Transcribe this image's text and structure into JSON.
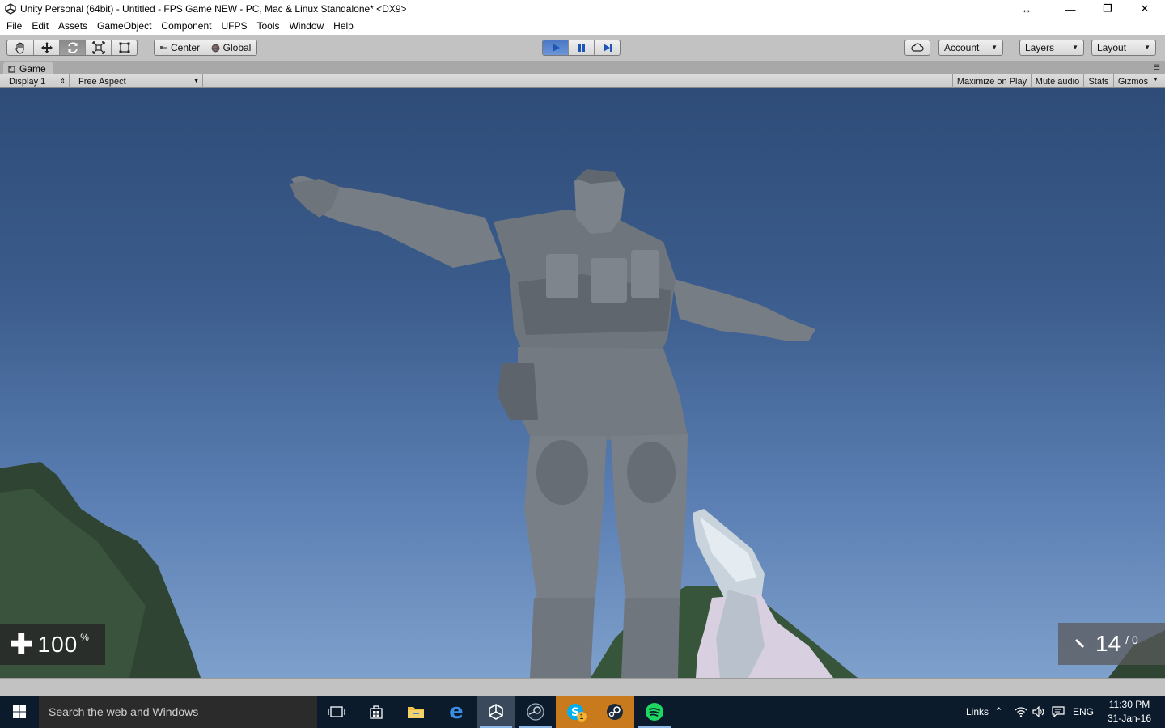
{
  "window": {
    "title": "Unity Personal (64bit) - Untitled - FPS Game NEW - PC, Mac & Linux Standalone* <DX9>",
    "controls": {
      "minimize": "—",
      "restore": "❐",
      "close": "✕",
      "resize": "↔"
    }
  },
  "menubar": [
    "File",
    "Edit",
    "Assets",
    "GameObject",
    "Component",
    "UFPS",
    "Tools",
    "Window",
    "Help"
  ],
  "toolbar": {
    "tools": [
      "hand-tool-icon",
      "move-tool-icon",
      "rotate-tool-icon",
      "scale-tool-icon",
      "rect-tool-icon"
    ],
    "active_tool": "rotate-tool-icon",
    "pivot_label": "Center",
    "space_label": "Global",
    "play_state": "playing",
    "account_label": "Account",
    "layers_label": "Layers",
    "layout_label": "Layout"
  },
  "game_panel": {
    "tab_label": "Game",
    "display_label": "Display 1",
    "aspect_label": "Free Aspect",
    "toggles": [
      "Maximize on Play",
      "Mute audio",
      "Stats",
      "Gizmos"
    ]
  },
  "hud": {
    "health_value": "100",
    "health_unit": "%",
    "ammo_clip": "14",
    "ammo_separator": "/",
    "ammo_reserve": "0"
  },
  "taskbar": {
    "search_placeholder": "Search the web and Windows",
    "apps": [
      "task-view-icon",
      "store-icon",
      "file-explorer-icon",
      "edge-icon",
      "unity-icon",
      "steam-client-icon",
      "skype-icon",
      "steam-icon",
      "spotify-icon"
    ],
    "skype_badge": "1",
    "links_label": "Links",
    "language": "ENG",
    "time": "11:30 PM",
    "date": "31-Jan-16"
  },
  "colors": {
    "sky_top": "#2f4c78",
    "sky_bottom": "#7ea0cc",
    "play_blue": "#4a78c4",
    "taskbar": "#0c1b2c"
  }
}
